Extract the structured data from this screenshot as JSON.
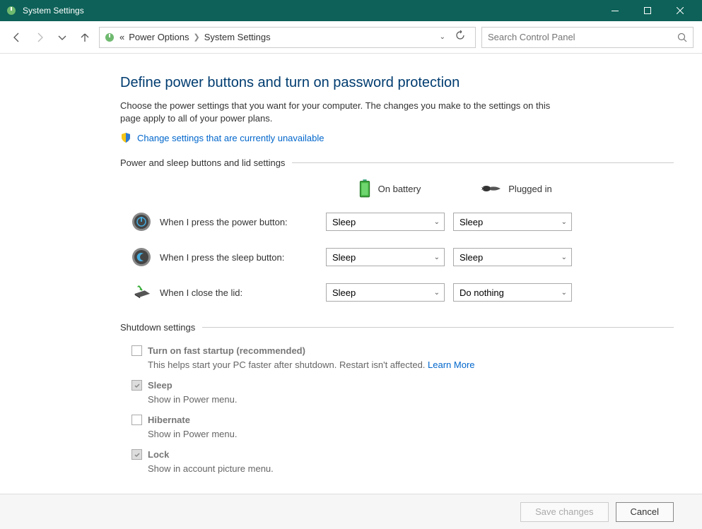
{
  "window": {
    "title": "System Settings"
  },
  "toolbar": {
    "breadcrumb_prefix": "«",
    "breadcrumb1": "Power Options",
    "breadcrumb2": "System Settings",
    "search_placeholder": "Search Control Panel"
  },
  "page": {
    "heading": "Define power buttons and turn on password protection",
    "description": "Choose the power settings that you want for your computer. The changes you make to the settings on this page apply to all of your power plans.",
    "change_link": "Change settings that are currently unavailable"
  },
  "power_section": {
    "header": "Power and sleep buttons and lid settings",
    "col_battery": "On battery",
    "col_plugged": "Plugged in",
    "rows": [
      {
        "label": "When I press the power button:",
        "battery": "Sleep",
        "plugged": "Sleep"
      },
      {
        "label": "When I press the sleep button:",
        "battery": "Sleep",
        "plugged": "Sleep"
      },
      {
        "label": "When I close the lid:",
        "battery": "Sleep",
        "plugged": "Do nothing"
      }
    ]
  },
  "shutdown_section": {
    "header": "Shutdown settings",
    "items": [
      {
        "label": "Turn on fast startup (recommended)",
        "desc": "This helps start your PC faster after shutdown. Restart isn't affected. ",
        "link": "Learn More",
        "checked": false
      },
      {
        "label": "Sleep",
        "desc": "Show in Power menu.",
        "checked": true
      },
      {
        "label": "Hibernate",
        "desc": "Show in Power menu.",
        "checked": false
      },
      {
        "label": "Lock",
        "desc": "Show in account picture menu.",
        "checked": true
      }
    ]
  },
  "footer": {
    "save": "Save changes",
    "cancel": "Cancel"
  }
}
